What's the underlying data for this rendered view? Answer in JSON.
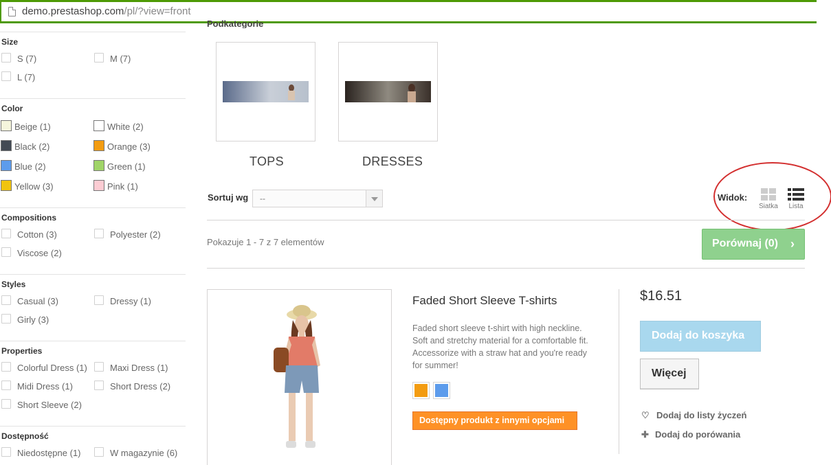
{
  "browser": {
    "url_host": "demo.prestashop.com",
    "url_path": "/pl/?view=front"
  },
  "sidebar": {
    "size": {
      "title": "Size",
      "options": [
        "S (7)",
        "M (7)",
        "L (7)"
      ]
    },
    "color": {
      "title": "Color",
      "options": [
        {
          "label": "Beige (1)",
          "color": "#f5f5dc"
        },
        {
          "label": "White (2)",
          "color": "#ffffff"
        },
        {
          "label": "Black (2)",
          "color": "#434a54"
        },
        {
          "label": "Orange (3)",
          "color": "#f39c11"
        },
        {
          "label": "Blue (2)",
          "color": "#5d9cec"
        },
        {
          "label": "Green (1)",
          "color": "#a0d468"
        },
        {
          "label": "Yellow (3)",
          "color": "#f1c40f"
        },
        {
          "label": "Pink (1)",
          "color": "#fcccd3"
        }
      ]
    },
    "compositions": {
      "title": "Compositions",
      "options": [
        "Cotton (3)",
        "Polyester (2)",
        "Viscose (2)"
      ]
    },
    "styles": {
      "title": "Styles",
      "options": [
        "Casual (3)",
        "Dressy (1)",
        "Girly (3)"
      ]
    },
    "properties": {
      "title": "Properties",
      "options": [
        "Colorful Dress (1)",
        "Maxi Dress (1)",
        "Midi Dress (1)",
        "Short Dress (2)",
        "Short Sleeve (2)"
      ]
    },
    "availability": {
      "title": "Dostępność",
      "options": [
        "Niedostępne (1)",
        "W magazynie (6)"
      ]
    }
  },
  "main": {
    "subcategories_label": "Podkategorie",
    "subcategories": [
      "TOPS",
      "DRESSES"
    ],
    "sort_label": "Sortuj wg",
    "sort_value": "--",
    "view_label": "Widok:",
    "view_grid": "Siatka",
    "view_list": "Lista",
    "showing": "Pokazuje 1 - 7 z 7 elementów",
    "compare_button": "Porównaj (0)"
  },
  "product": {
    "name": "Faded Short Sleeve T-shirts",
    "description": "Faded short sleeve t-shirt with high neckline. Soft and stretchy material for a comfortable fit. Accessorize with a straw hat and you're ready for summer!",
    "colors": [
      "#f39c11",
      "#5d9cec"
    ],
    "availability": "Dostępny produkt z innymi opcjami",
    "price": "$16.51",
    "add_to_cart": "Dodaj do koszyka",
    "more": "Więcej",
    "wishlist": "Dodaj do listy życzeń",
    "compare": "Dodaj do porówania"
  }
}
